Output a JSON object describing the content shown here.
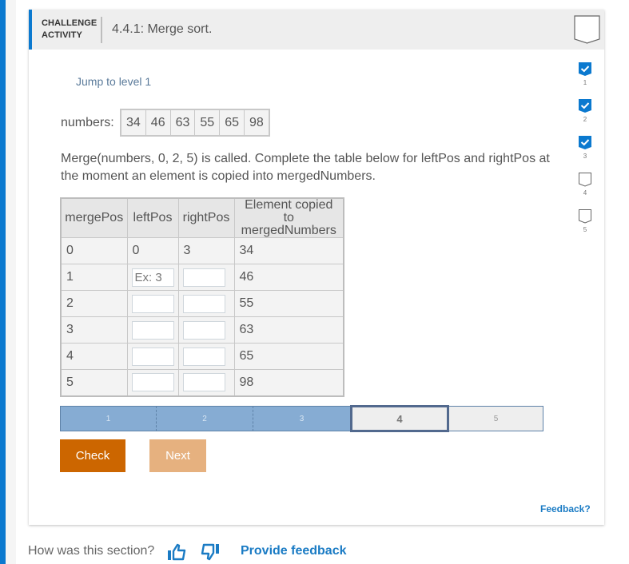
{
  "header": {
    "activity_type_line1": "CHALLENGE",
    "activity_type_line2": "ACTIVITY",
    "title": "4.4.1: Merge sort.",
    "badge_icon": "ribbon-badge-icon"
  },
  "jump_link": "Jump to level 1",
  "numbers": {
    "label": "numbers:",
    "values": [
      "34",
      "46",
      "63",
      "55",
      "65",
      "98"
    ]
  },
  "prompt": "Merge(numbers, 0, 2, 5) is called. Complete the table below for leftPos and rightPos at the moment an element is copied into mergedNumbers.",
  "table": {
    "headers": [
      "mergePos",
      "leftPos",
      "rightPos",
      "Element copied to mergedNumbers"
    ],
    "rows": [
      {
        "mergePos": "0",
        "leftPos": "0",
        "rightPos": "3",
        "element": "34"
      },
      {
        "mergePos": "1",
        "leftPos_placeholder": "Ex: 3",
        "leftPos_value": "",
        "rightPos_value": "",
        "element": "46"
      },
      {
        "mergePos": "2",
        "leftPos_value": "",
        "rightPos_value": "",
        "element": "55"
      },
      {
        "mergePos": "3",
        "leftPos_value": "",
        "rightPos_value": "",
        "element": "63"
      },
      {
        "mergePos": "4",
        "leftPos_value": "",
        "rightPos_value": "",
        "element": "65"
      },
      {
        "mergePos": "5",
        "leftPos_value": "",
        "rightPos_value": "",
        "element": "98"
      }
    ]
  },
  "progress": {
    "levels": [
      "1",
      "2",
      "3",
      "4",
      "5"
    ],
    "completed": 3,
    "current": "4"
  },
  "buttons": {
    "check": "Check",
    "next": "Next"
  },
  "feedback_link": "Feedback?",
  "level_sidebar": [
    {
      "label": "1",
      "status": "completed"
    },
    {
      "label": "2",
      "status": "completed"
    },
    {
      "label": "3",
      "status": "completed"
    },
    {
      "label": "4",
      "status": "incomplete"
    },
    {
      "label": "5",
      "status": "incomplete"
    }
  ],
  "colors": {
    "accent_blue": "#0b79cf",
    "link_blue": "#1a7bc4",
    "check_orange": "#cc6600",
    "next_orange_disabled": "#e6b17f",
    "progress_done": "#86acd3",
    "progress_current_border": "#52698e"
  },
  "footer": {
    "question": "How was this section?",
    "thumbs_up_icon": "thumbs-up-icon",
    "thumbs_down_icon": "thumbs-down-icon",
    "provide_feedback": "Provide feedback"
  }
}
